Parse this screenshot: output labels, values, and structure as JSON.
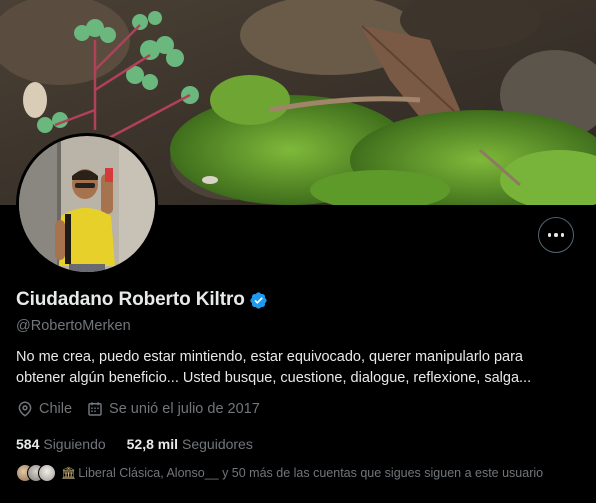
{
  "profile": {
    "display_name": "Ciudadano Roberto Kiltro",
    "handle": "@RobertoMerken",
    "bio": "No me crea, puedo estar mintiendo, estar equivocado, querer manipularlo para obtener algún beneficio... Usted busque, cuestione, dialogue, reflexione, salga...",
    "location": "Chile",
    "joined": "Se unió el julio de 2017",
    "verified_badge_color": "#1d9bf0"
  },
  "stats": {
    "following_count": "584",
    "following_label": "Siguiendo",
    "followers_count": "52,8 mil",
    "followers_label": "Seguidores"
  },
  "followers_you_know": {
    "text": "Liberal Clásica, Alonso__ y 50 más de las cuentas que sigues siguen a este usuario",
    "icon": "museum-icon"
  },
  "colors": {
    "background": "#000000",
    "primary_text": "#e7e9ea",
    "secondary_text": "#71767b",
    "accent": "#1d9bf0"
  },
  "icons": {
    "more": "more-horizontal-icon",
    "location": "location-pin-icon",
    "calendar": "calendar-icon",
    "verified": "verified-badge-icon"
  }
}
